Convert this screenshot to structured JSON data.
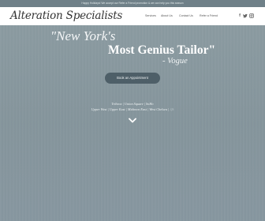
{
  "announcement": "Happy Holidays! We accept our Refer a Friend promotion & we can help you this season",
  "header": {
    "logo": "Alteration Specialists",
    "nav": [
      "Services",
      "About Us",
      "Contact Us",
      "Refer a Friend"
    ],
    "social": {
      "facebook": "f",
      "twitter": "t"
    }
  },
  "hero": {
    "quote_line1": "\"New York's",
    "quote_line2": "Most Genius Tailor\"",
    "quote_attribution": "- Vogue",
    "cta_label": "Book an Appointment",
    "locations_line1": "Tribeca | Union Square | SoHo",
    "locations_line2": "Upper West | Upper East | Midtown East | West Chelsea |",
    "locations_line2_dim": "Jfk"
  },
  "colors": {
    "hero_background": "#8a9aa0",
    "cta_background": "#4e5f68",
    "header_background": "#ffffff"
  }
}
